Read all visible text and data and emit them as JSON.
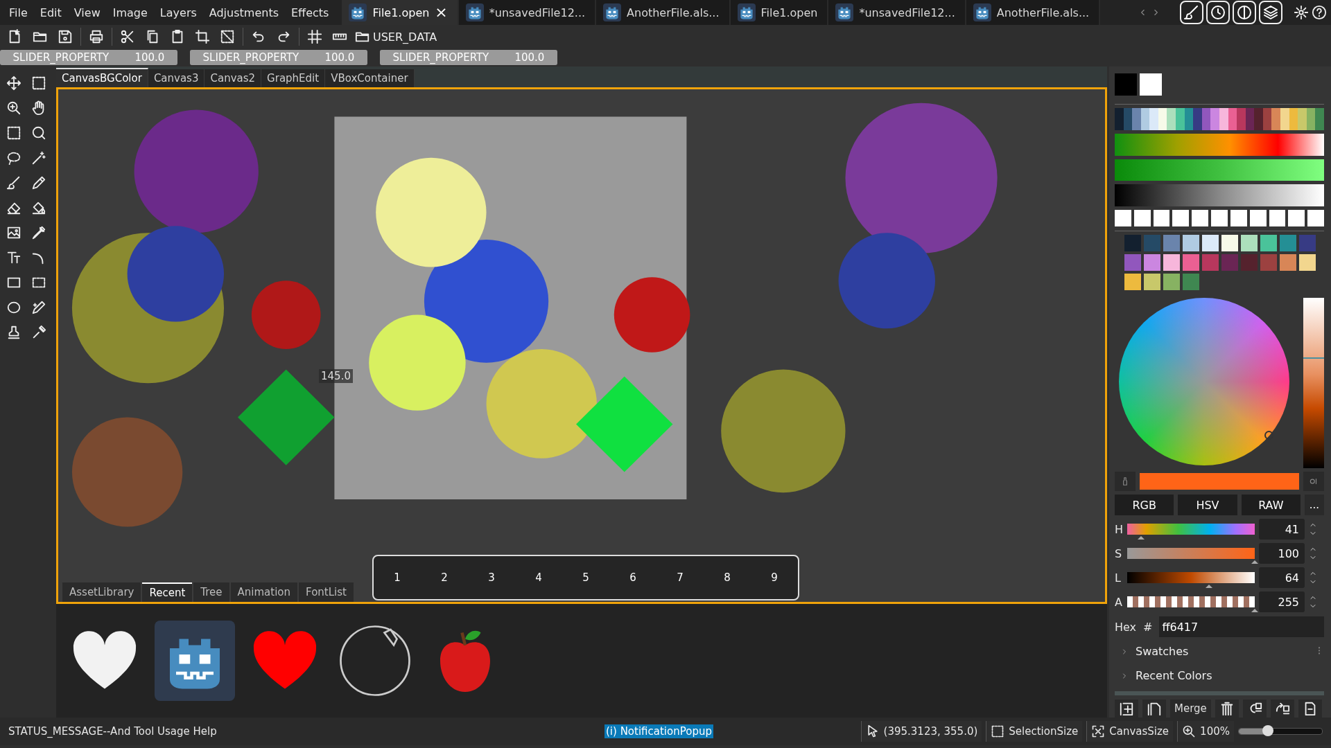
{
  "menu": [
    "File",
    "Edit",
    "View",
    "Image",
    "Layers",
    "Adjustments",
    "Effects"
  ],
  "document_tabs": [
    {
      "label": "File1.open",
      "selected": true,
      "close": "×"
    },
    {
      "label": "*unsavedFile12...",
      "selected": false
    },
    {
      "label": "AnotherFile.als...",
      "selected": false
    },
    {
      "label": "File1.open",
      "selected": false
    },
    {
      "label": "*unsavedFile12...",
      "selected": false
    },
    {
      "label": "AnotherFile.als...",
      "selected": false
    }
  ],
  "toolbar": {
    "folder": "USER_DATA"
  },
  "sliders": [
    {
      "label": "SLIDER_PROPERTY",
      "value": "100.0",
      "level": 1
    },
    {
      "label": "SLIDER_PROPERTY",
      "value": "100.0",
      "level": 1
    },
    {
      "label": "SLIDER_PROPERTY",
      "value": "100.0",
      "level": 1
    }
  ],
  "canvas_tabs": [
    {
      "label": "CanvasBGColor",
      "selected": true
    },
    {
      "label": "Canvas3",
      "selected": false
    },
    {
      "label": "Canvas2",
      "selected": false
    },
    {
      "label": "GraphEdit",
      "selected": false
    },
    {
      "label": "VBoxContainer",
      "selected": false
    }
  ],
  "canvas": {
    "ruler_value": "145.0",
    "frames": [
      "1",
      "2",
      "3",
      "4",
      "5",
      "6",
      "7",
      "8",
      "9"
    ]
  },
  "bottom_tabs": [
    {
      "label": "AssetLibrary",
      "selected": false
    },
    {
      "label": "Recent",
      "selected": true
    },
    {
      "label": "Tree",
      "selected": false
    },
    {
      "label": "Animation",
      "selected": false
    },
    {
      "label": "FontList",
      "selected": false
    }
  ],
  "assets": [
    {
      "kind": "heart",
      "color": "#f2f2f2",
      "selected": false
    },
    {
      "kind": "robot",
      "color": "#478cbf",
      "selected": true
    },
    {
      "kind": "heart",
      "color": "#ff0000",
      "selected": false
    },
    {
      "kind": "circle",
      "color": "#cccccc",
      "selected": false
    },
    {
      "kind": "apple",
      "color": "#d91a1a",
      "selected": false
    }
  ],
  "color_picker": {
    "primary": {
      "color": "#000000"
    },
    "secondary": {
      "color": "#ffffff"
    },
    "palette": [
      {
        "color": "#13202f"
      },
      {
        "color": "#254a66"
      },
      {
        "color": "#6a84ac"
      },
      {
        "color": "#b0cbe2"
      },
      {
        "color": "#dbe9f8"
      },
      {
        "color": "#f7fae9"
      },
      {
        "color": "#acdfbc"
      },
      {
        "color": "#4ac39a"
      },
      {
        "color": "#248f95"
      },
      {
        "color": "#373b84"
      },
      {
        "color": "#9157bd"
      },
      {
        "color": "#cb86e0"
      },
      {
        "color": "#f7b6db"
      },
      {
        "color": "#ea6093"
      },
      {
        "color": "#b8375d"
      },
      {
        "color": "#6a2554"
      },
      {
        "color": "#55222d"
      },
      {
        "color": "#9c4140"
      },
      {
        "color": "#d88657"
      },
      {
        "color": "#f2d68e"
      },
      {
        "color": "#edba3e"
      },
      {
        "color": "#c8c86a"
      },
      {
        "color": "#87b262"
      },
      {
        "color": "#3f8751"
      }
    ],
    "recent_slots": [
      {
        "color": "#ffffff"
      },
      {
        "color": "#ffffff"
      },
      {
        "color": "#ffffff"
      },
      {
        "color": "#ffffff"
      },
      {
        "color": "#ffffff"
      },
      {
        "color": "#ffffff"
      },
      {
        "color": "#ffffff"
      },
      {
        "color": "#ffffff"
      },
      {
        "color": "#ffffff"
      },
      {
        "color": "#ffffff"
      },
      {
        "color": "#ffffff"
      }
    ],
    "swatches": [
      {
        "color": "#13202f"
      },
      {
        "color": "#254a66"
      },
      {
        "color": "#6a84ac"
      },
      {
        "color": "#b0cbe2"
      },
      {
        "color": "#dbe9f8"
      },
      {
        "color": "#f7fae9"
      },
      {
        "color": "#acdfbc"
      },
      {
        "color": "#4ac39a"
      },
      {
        "color": "#248f95"
      },
      {
        "color": "#373b84"
      },
      {
        "color": "#9157bd"
      },
      {
        "color": "#cb86e0"
      },
      {
        "color": "#f7b6db"
      },
      {
        "color": "#ea6093"
      },
      {
        "color": "#b8375d"
      },
      {
        "color": "#6a2554"
      },
      {
        "color": "#55222d"
      },
      {
        "color": "#9c4140"
      },
      {
        "color": "#d88657"
      },
      {
        "color": "#f2d68e"
      },
      {
        "color": "#edba3e"
      },
      {
        "color": "#c8c86a"
      },
      {
        "color": "#87b262"
      },
      {
        "color": "#3f8751"
      }
    ],
    "value_slider": {
      "level": 0.65
    },
    "current": {
      "color": "#ff6417"
    },
    "modes": [
      "RGB",
      "HSV",
      "RAW"
    ],
    "more": "...",
    "channels": [
      {
        "name": "H",
        "value": "41",
        "level": 0.11
      },
      {
        "name": "S",
        "value": "100",
        "level": 1
      },
      {
        "name": "L",
        "value": "64",
        "level": 0.64
      },
      {
        "name": "A",
        "value": "255",
        "level": 1
      }
    ],
    "hex_label": "Hex",
    "hex_prefix": "#",
    "hex": "ff6417",
    "sections": [
      {
        "label": "Swatches",
        "expanded": false
      },
      {
        "label": "Recent Colors",
        "expanded": false
      }
    ]
  },
  "layer_buttons": {
    "merge": "Merge"
  },
  "status_bar": {
    "message": "STATUS_MESSAGE--And Tool Usage Help",
    "notification": "(i) NotificationPopup",
    "cursor": "(395.3123, 355.0)",
    "selection": "SelectionSize",
    "canvas_size": "CanvasSize",
    "zoom": "100%",
    "zoom_slider": {
      "level": 0.35
    }
  }
}
